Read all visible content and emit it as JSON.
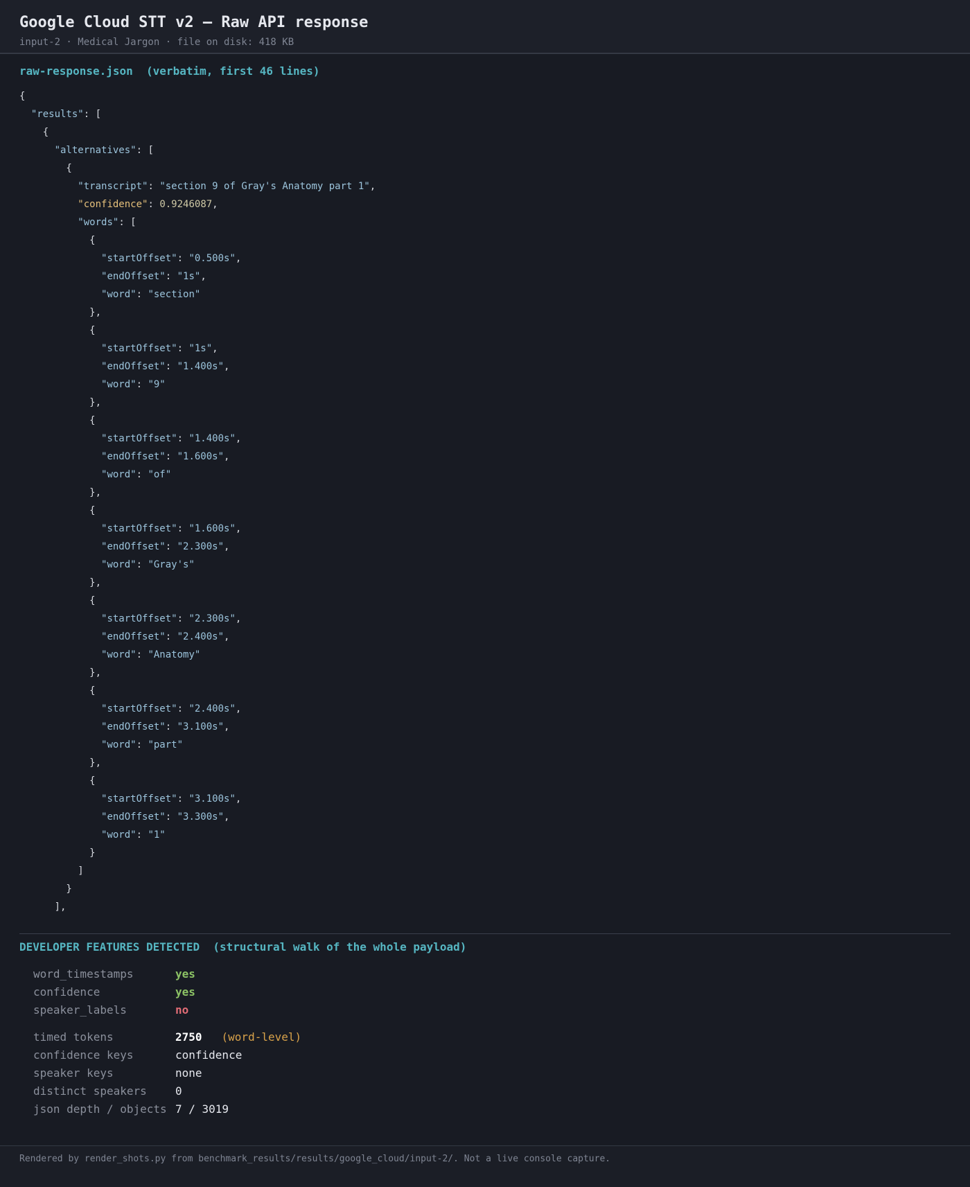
{
  "header": {
    "title": "Google Cloud STT v2 — Raw API response",
    "subtitle": "input-2 · Medical Jargon · file on disk: 418 KB"
  },
  "code_panel": {
    "filename": "raw-response.json",
    "note": "(verbatim, first 46 lines)",
    "lines": [
      "{",
      "  \"results\": [",
      "    {",
      "      \"alternatives\": [",
      "        {",
      "          \"transcript\": \"section 9 of Gray's Anatomy part 1\",",
      "          \"confidence\": 0.9246087,",
      "          \"words\": [",
      "            {",
      "              \"startOffset\": \"0.500s\",",
      "              \"endOffset\": \"1s\",",
      "              \"word\": \"section\"",
      "            },",
      "            {",
      "              \"startOffset\": \"1s\",",
      "              \"endOffset\": \"1.400s\",",
      "              \"word\": \"9\"",
      "            },",
      "            {",
      "              \"startOffset\": \"1.400s\",",
      "              \"endOffset\": \"1.600s\",",
      "              \"word\": \"of\"",
      "            },",
      "            {",
      "              \"startOffset\": \"1.600s\",",
      "              \"endOffset\": \"2.300s\",",
      "              \"word\": \"Gray's\"",
      "            },",
      "            {",
      "              \"startOffset\": \"2.300s\",",
      "              \"endOffset\": \"2.400s\",",
      "              \"word\": \"Anatomy\"",
      "            },",
      "            {",
      "              \"startOffset\": \"2.400s\",",
      "              \"endOffset\": \"3.100s\",",
      "              \"word\": \"part\"",
      "            },",
      "            {",
      "              \"startOffset\": \"3.100s\",",
      "              \"endOffset\": \"3.300s\",",
      "              \"word\": \"1\"",
      "            }",
      "          ]",
      "        }",
      "      ],"
    ]
  },
  "features": {
    "heading": "DEVELOPER FEATURES DETECTED",
    "heading_note": "(structural walk of the whole payload)",
    "flags": [
      {
        "label": "word_timestamps",
        "value": "yes",
        "status": "yes"
      },
      {
        "label": "confidence",
        "value": "yes",
        "status": "yes"
      },
      {
        "label": "speaker_labels",
        "value": "no",
        "status": "no"
      }
    ],
    "stats": [
      {
        "label": "timed tokens",
        "value": "2750",
        "note": "(word-level)",
        "bold": true
      },
      {
        "label": "confidence keys",
        "value": "confidence"
      },
      {
        "label": "speaker keys",
        "value": "none"
      },
      {
        "label": "distinct speakers",
        "value": "0"
      },
      {
        "label": "json depth / objects",
        "value": "7 / 3019"
      }
    ]
  },
  "footer": {
    "text": "Rendered by render_shots.py from benchmark_results/results/google_cloud/input-2/. Not a live console capture."
  },
  "colors": {
    "background": "#181b23",
    "accent": "#56b6c2",
    "yes": "#8cc265",
    "no": "#e06c75",
    "note": "#d8a24a"
  }
}
